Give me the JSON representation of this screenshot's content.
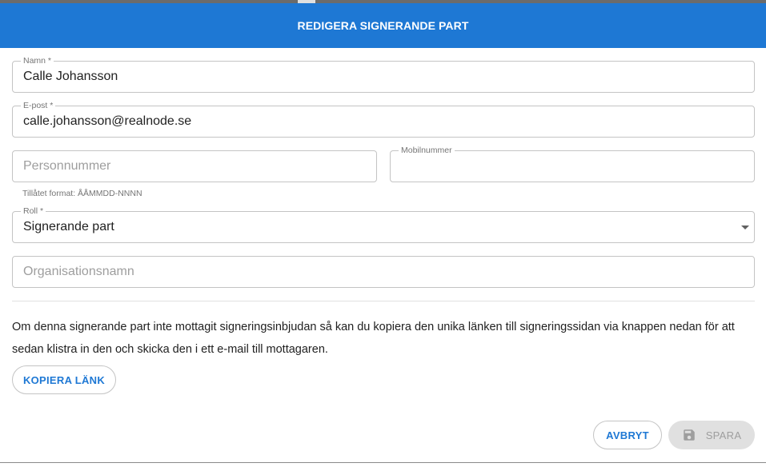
{
  "dialog": {
    "title": "REDIGERA SIGNERANDE PART"
  },
  "form": {
    "name": {
      "label": "Namn *",
      "value": "Calle Johansson"
    },
    "email": {
      "label": "E-post *",
      "value": "calle.johansson@realnode.se"
    },
    "personnummer": {
      "placeholder": "Personnummer",
      "helper": "Tillåtet format: ÅÅMMDD-NNNN"
    },
    "mobile": {
      "label": "Mobilnummer",
      "value": ""
    },
    "role": {
      "label": "Roll *",
      "value": "Signerande part"
    },
    "organisation": {
      "placeholder": "Organisationsnamn"
    }
  },
  "info_text": "Om denna signerande part inte mottagit signeringsinbjudan så kan du kopiera den unika länken till signeringssidan via knappen nedan för att sedan klistra in den och skicka den i ett e-mail till mottagaren.",
  "buttons": {
    "copy_link": "KOPIERA LÄNK",
    "cancel": "AVBRYT",
    "save": "SPARA"
  },
  "colors": {
    "header": "#1e78d4",
    "accent": "#1e78d4",
    "disabled": "#e0e0e0"
  },
  "icons": {
    "save": "floppy-disk-icon",
    "dropdown": "chevron-down-icon"
  }
}
